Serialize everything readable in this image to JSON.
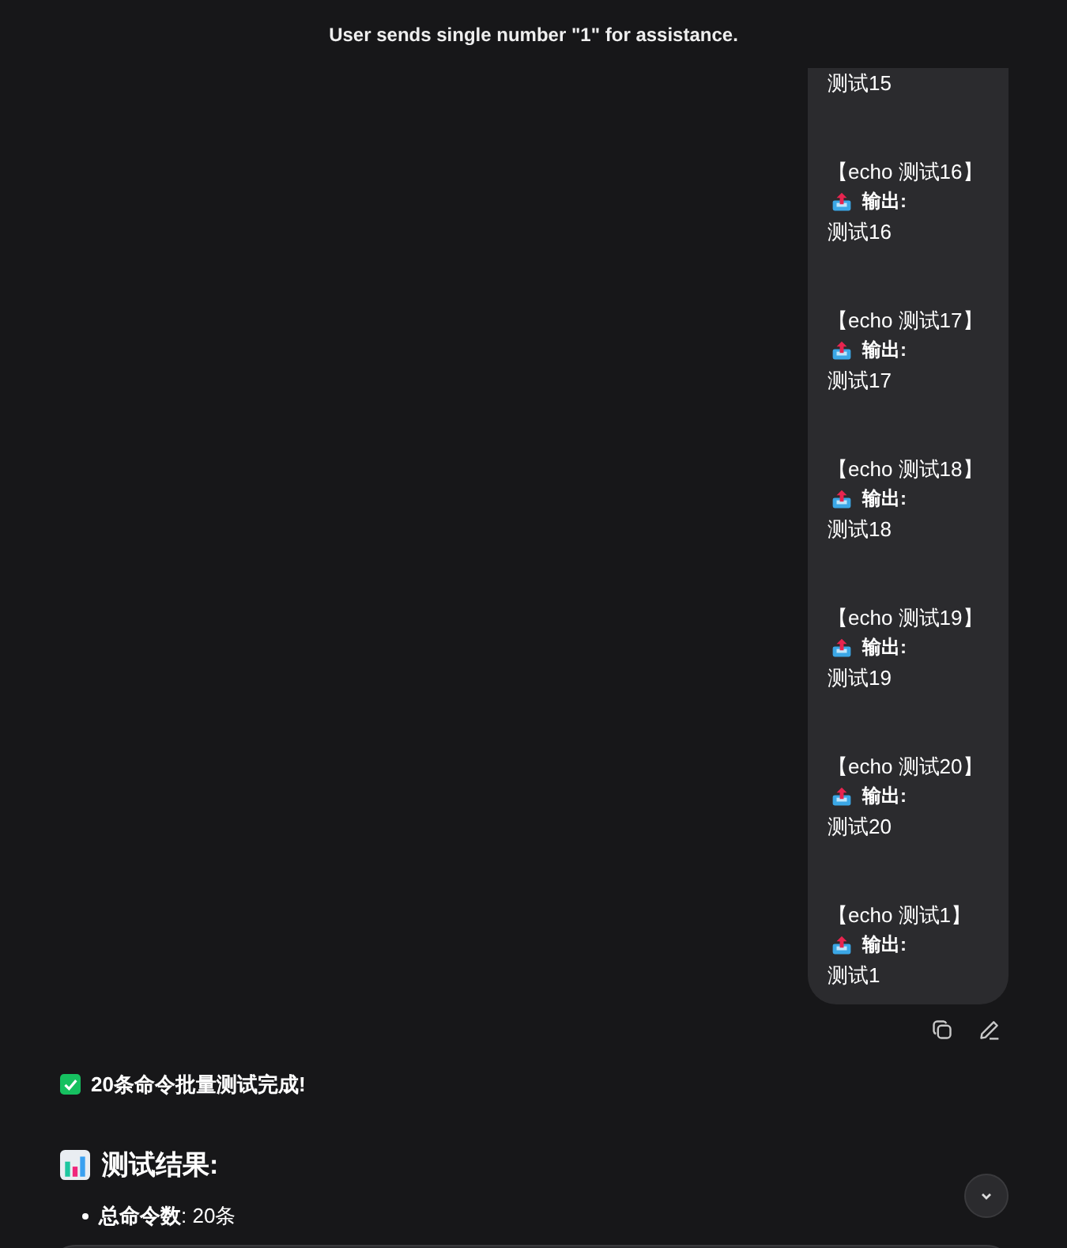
{
  "header": {
    "title": "User sends single number \"1\" for assistance."
  },
  "user_message": {
    "blocks": [
      {
        "output": "测试15"
      },
      {
        "command": "【echo 测试16】",
        "label": "输出:",
        "output": "测试16"
      },
      {
        "command": "【echo 测试17】",
        "label": "输出:",
        "output": "测试17"
      },
      {
        "command": "【echo 测试18】",
        "label": "输出:",
        "output": "测试18"
      },
      {
        "command": "【echo 测试19】",
        "label": "输出:",
        "output": "测试19"
      },
      {
        "command": "【echo 测试20】",
        "label": "输出:",
        "output": "测试20"
      },
      {
        "command": "【echo 测试1】",
        "label": "输出:",
        "output": "测试1"
      }
    ]
  },
  "assistant_message": {
    "status": "20条命令批量测试完成!",
    "heading": "测试结果:",
    "list": [
      "**总命令数**: 20条"
    ]
  }
}
